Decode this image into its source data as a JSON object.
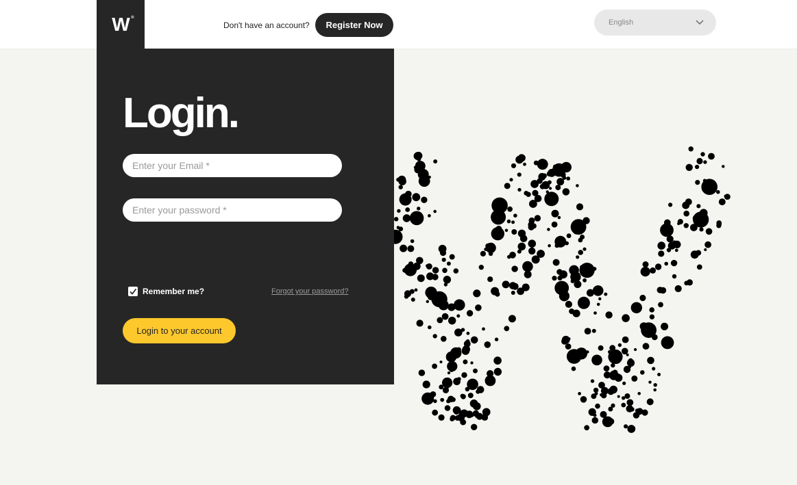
{
  "header": {
    "logo_letter": "W",
    "logo_mark": "®",
    "no_account_text": "Don't have an account?",
    "register_label": "Register Now",
    "language": "English"
  },
  "login": {
    "title": "Login.",
    "email_placeholder": "Enter your Email *",
    "password_placeholder": "Enter your password *",
    "remember_label": "Remember me?",
    "remember_checked": true,
    "forgot_label": "Forgot your password?",
    "submit_label": "Login to your account"
  },
  "colors": {
    "dark": "#262626",
    "accent": "#fdc82c",
    "background": "#f4f4f0"
  },
  "icons": {
    "language_dropdown": "chevron-down-icon",
    "remember_check": "checkmark-icon",
    "decorative_art": "dotted-w-logo"
  }
}
